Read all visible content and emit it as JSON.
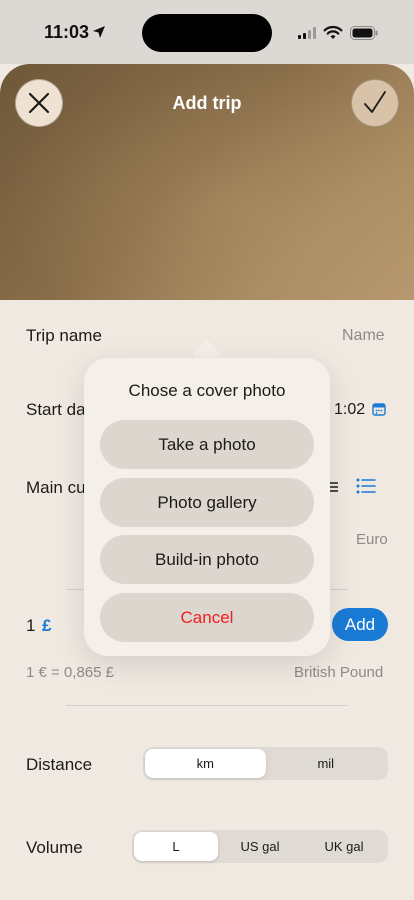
{
  "status": {
    "time": "11:03"
  },
  "header": {
    "title": "Add trip"
  },
  "form": {
    "trip_name_label": "Trip name",
    "trip_name_placeholder": "Name",
    "start_date_label": "Start da",
    "start_time_partial": "1:02",
    "main_currency_label": "Main cu",
    "main_currency_value": "Euro",
    "rate_amount": "1",
    "rate_symbol": "£",
    "rate_formula": "1 € = 0,865 £",
    "rate_currency_name": "British Pound",
    "add_label": "Add",
    "distance_label": "Distance",
    "distance_options": [
      "km",
      "mil"
    ],
    "distance_selected": "km",
    "volume_label": "Volume",
    "volume_options": [
      "L",
      "US gal",
      "UK gal"
    ],
    "volume_selected": "L"
  },
  "popover": {
    "title": "Chose a cover photo",
    "take_photo": "Take a photo",
    "gallery": "Photo gallery",
    "builtin": "Build-in photo",
    "cancel": "Cancel"
  },
  "colors": {
    "accent": "#1a7bd6",
    "destructive": "#ef2020",
    "muted_text": "#8d8a86"
  }
}
